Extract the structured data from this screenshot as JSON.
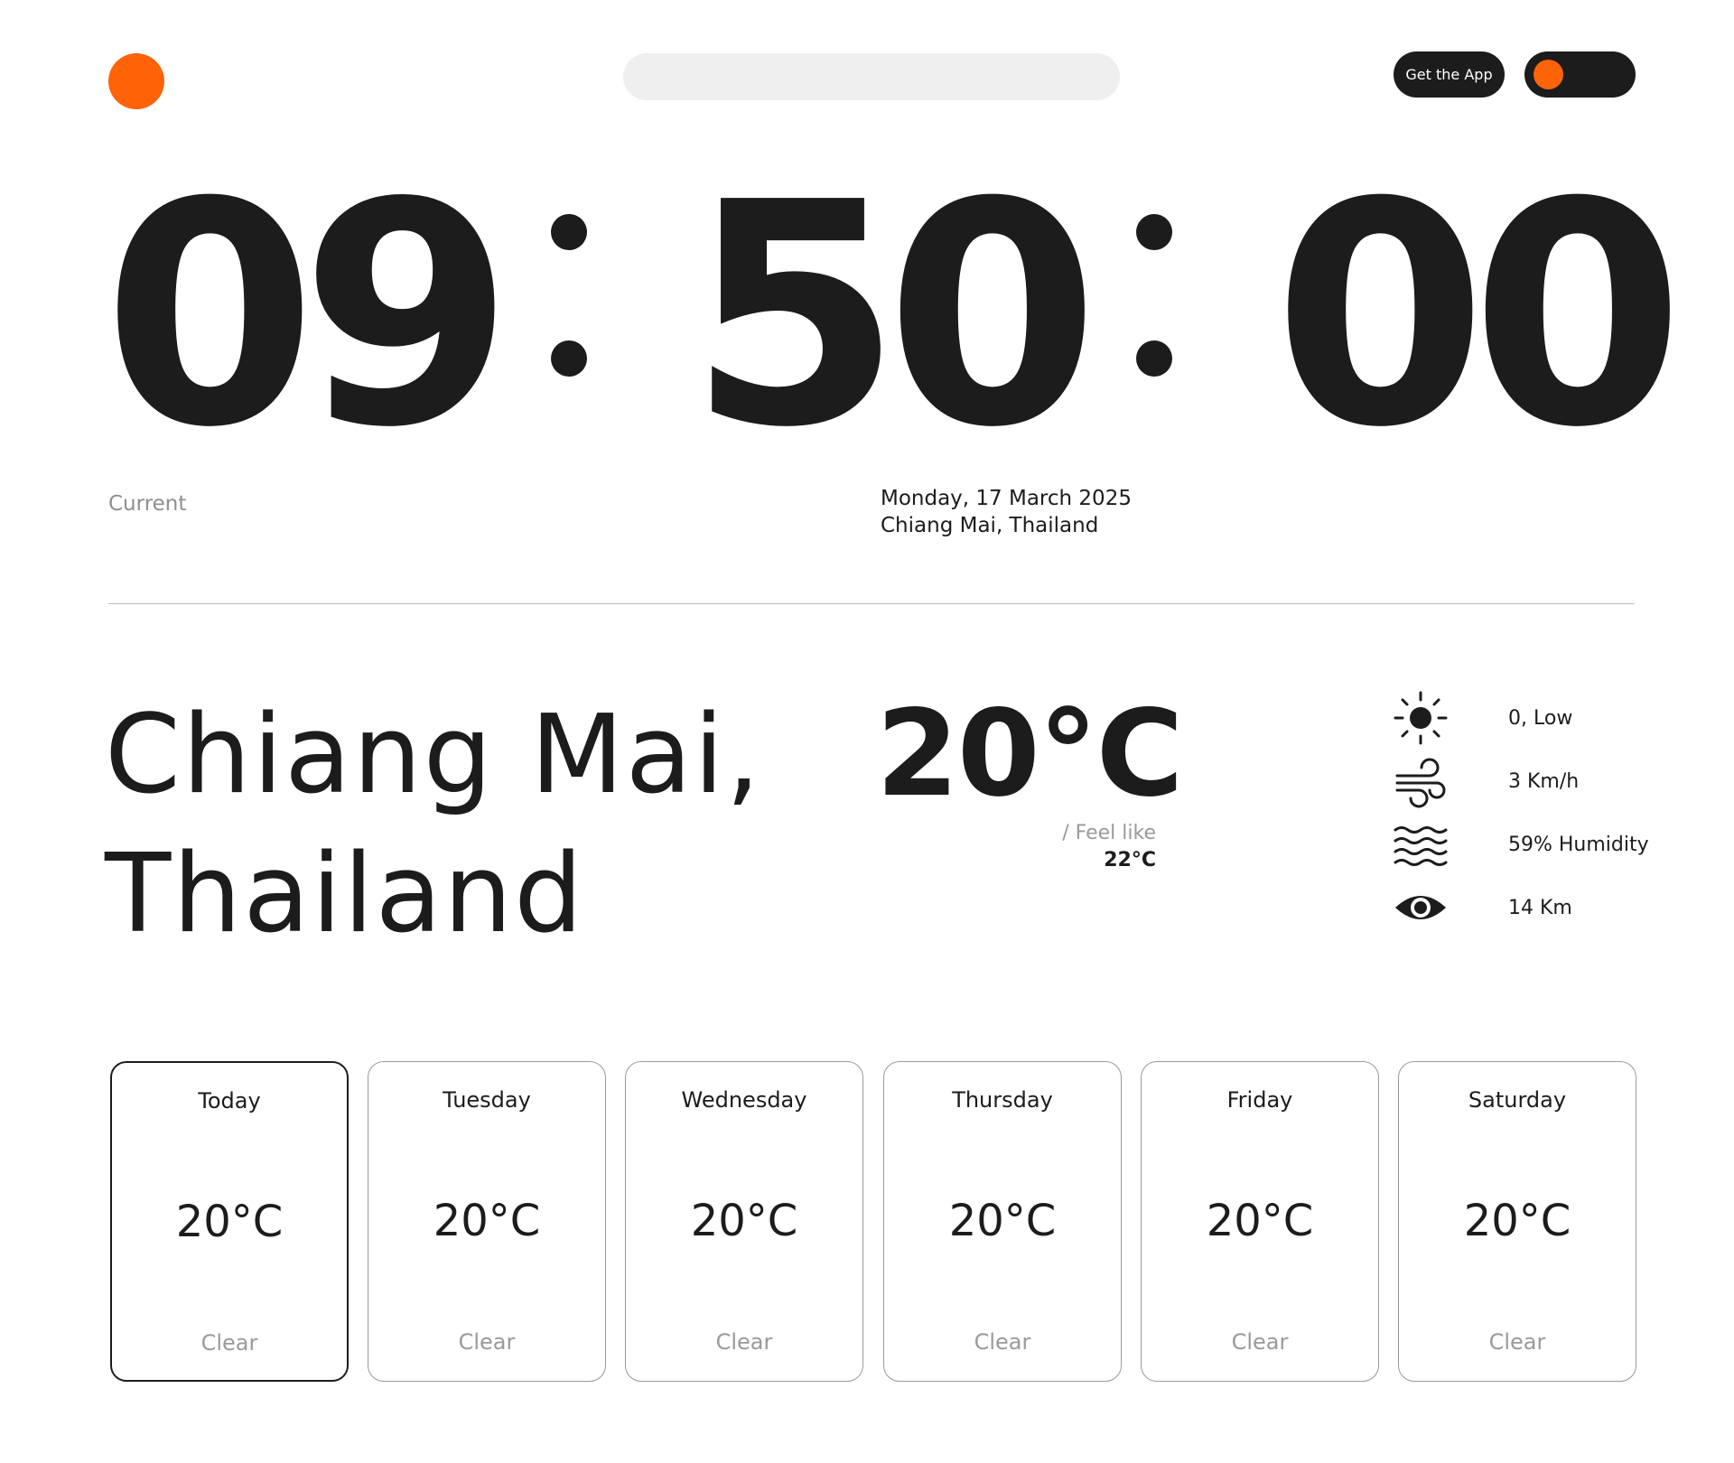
{
  "colors": {
    "accent": "#ff6308",
    "dark": "#1c1c1c",
    "muted": "#9a9a9a",
    "search_bg": "#efefef"
  },
  "header": {
    "search": {
      "value": "",
      "placeholder": ""
    },
    "get_app_label": "Get the App",
    "theme_toggle_icon": "toggle-switch"
  },
  "clock": {
    "hours": "09",
    "minutes": "50",
    "seconds": "00"
  },
  "current_label": "Current",
  "date": {
    "line1": "Monday, 17 March 2025",
    "line2": "Chiang Mai, Thailand"
  },
  "weather": {
    "city_line1": "Chiang Mai,",
    "city_line2": "Thailand",
    "temperature": "20°C",
    "feel_like_label": "/ Feel like",
    "feel_like_value": "22°C",
    "stats": [
      {
        "icon": "sun-icon",
        "value": "0, Low"
      },
      {
        "icon": "wind-icon",
        "value": "3 Km/h"
      },
      {
        "icon": "waves-icon",
        "value": "59% Humidity"
      },
      {
        "icon": "eye-icon",
        "value": "14 Km"
      }
    ]
  },
  "forecast": [
    {
      "day": "Today",
      "temp": "20°C",
      "condition": "Clear"
    },
    {
      "day": "Tuesday",
      "temp": "20°C",
      "condition": "Clear"
    },
    {
      "day": "Wednesday",
      "temp": "20°C",
      "condition": "Clear"
    },
    {
      "day": "Thursday",
      "temp": "20°C",
      "condition": "Clear"
    },
    {
      "day": "Friday",
      "temp": "20°C",
      "condition": "Clear"
    },
    {
      "day": "Saturday",
      "temp": "20°C",
      "condition": "Clear"
    }
  ]
}
